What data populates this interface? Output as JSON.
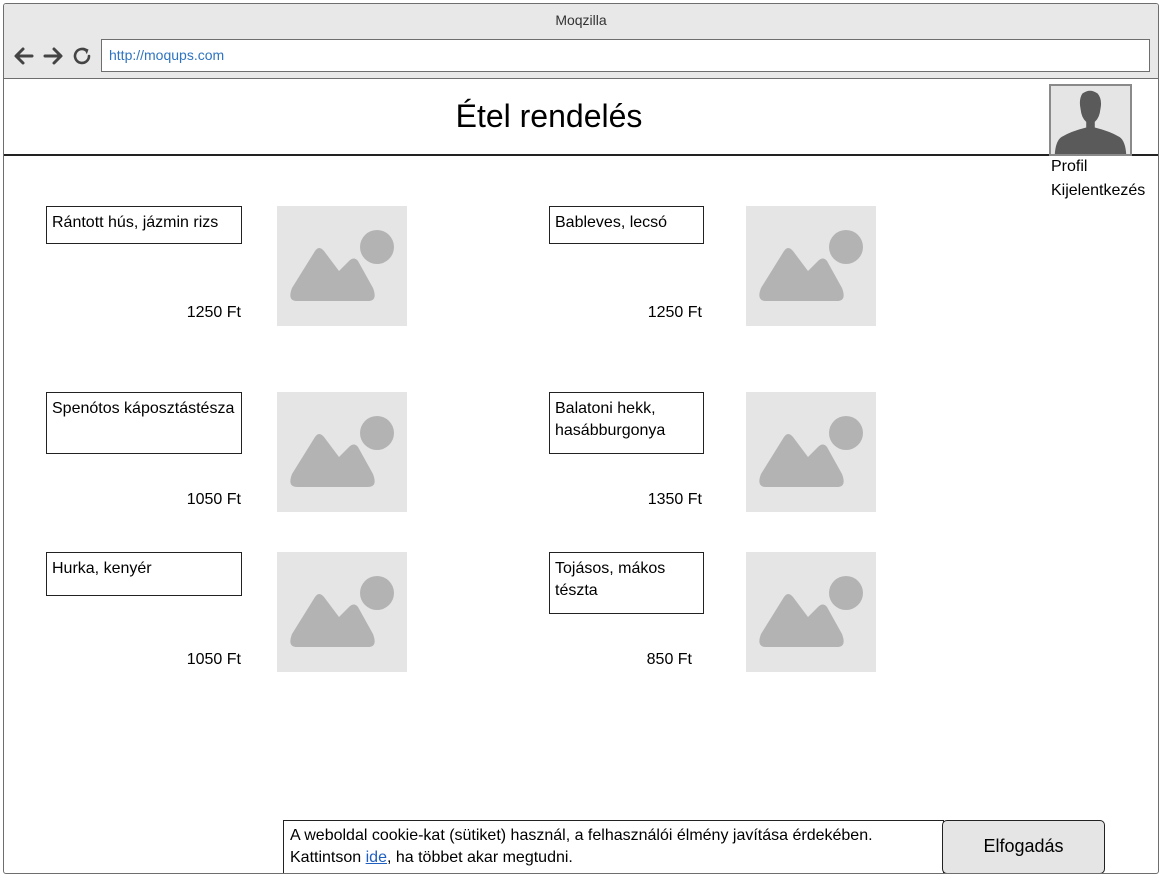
{
  "window": {
    "title": "Moqzilla"
  },
  "browser": {
    "url": "http://moqups.com",
    "back_icon": "arrow-left-icon",
    "forward_icon": "arrow-right-icon",
    "reload_icon": "reload-icon"
  },
  "header": {
    "title": "Étel rendelés",
    "avatar_icon": "user-silhouette-icon",
    "profile_label": "Profil",
    "logout_label": "Kijelentkezés"
  },
  "menu": {
    "items": [
      {
        "name": "Rántott hús, jázmin rizs",
        "price": "1250 Ft"
      },
      {
        "name": "Bableves, lecsó",
        "price": "1250 Ft"
      },
      {
        "name": "Spenótos káposztástészа",
        "price": "1050 Ft"
      },
      {
        "name": "Balatoni hekk, hasábburgonya",
        "price": "1350 Ft"
      },
      {
        "name": "Hurka, kenyér",
        "price": "1050 Ft"
      },
      {
        "name": "Tojásos, mákos tészta",
        "price": "850 Ft"
      }
    ],
    "image_icon": "image-placeholder-icon"
  },
  "cookie": {
    "text_line1": "A weboldal cookie-kat (sütiket) használ, a felhasználói élmény javítása érdekében.",
    "text_before_link": "Kattintson ",
    "link_label": "ide",
    "text_after_link": ", ha többet akar megtudni.",
    "accept_label": "Elfogadás"
  }
}
